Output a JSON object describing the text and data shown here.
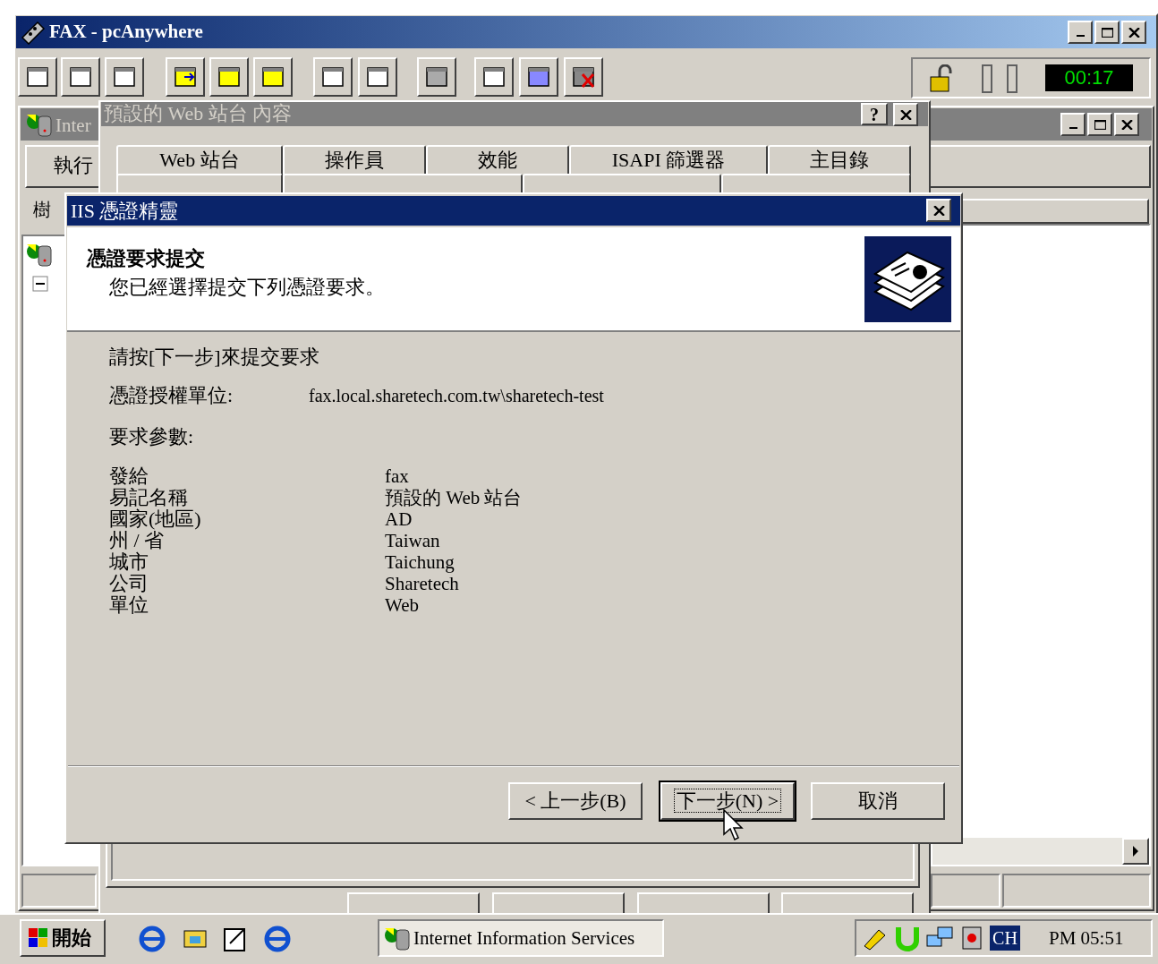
{
  "main_window": {
    "title": "FAX - pcAnywhere",
    "timer": "00:17"
  },
  "mmc_window": {
    "title": "Inter",
    "toolbar_label": "執行",
    "pane_label": "樹"
  },
  "properties_dialog": {
    "title": "預設的 Web 站台 內容",
    "help_button": "?",
    "tabs_row_1": [
      "Web 站台",
      "操作員",
      "效能",
      "ISAPI 篩選器",
      "主目錄"
    ]
  },
  "wizard": {
    "title": "IIS 憑證精靈",
    "heading": "憑證要求提交",
    "subheading": "您已經選擇提交下列憑證要求。",
    "instruction": "請按[下一步]來提交要求",
    "authority_label": "憑證授權單位:",
    "authority_value": "fax.local.sharetech.com.tw\\sharetech-test",
    "params_label": "要求參數:",
    "params": [
      {
        "name": "發給",
        "value": "fax"
      },
      {
        "name": "易記名稱",
        "value": "預設的 Web 站台"
      },
      {
        "name": "國家(地區)",
        "value": "AD"
      },
      {
        "name": "州 / 省",
        "value": "Taiwan"
      },
      {
        "name": "城市",
        "value": "Taichung"
      },
      {
        "name": "公司",
        "value": "Sharetech"
      },
      {
        "name": "單位",
        "value": "Web"
      }
    ],
    "buttons": [
      {
        "label": "< 上一步(B)",
        "focused": false
      },
      {
        "label": "下一步(N) >",
        "focused": true
      },
      {
        "label": "取消",
        "focused": false
      }
    ]
  },
  "taskbar": {
    "start": "開始",
    "tasks": [
      {
        "label": "Internet Information Services",
        "selected": true
      }
    ],
    "language": "CH",
    "clock": "PM 05:51"
  }
}
